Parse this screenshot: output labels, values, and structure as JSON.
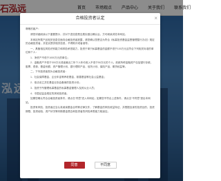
{
  "site": {
    "logo_text": "石泓远",
    "nav": [
      "首页",
      "市场观点",
      "产品中心",
      "关于我们",
      "联系我们"
    ]
  },
  "hero": {
    "text": "泓远"
  },
  "modal": {
    "title": "合格投资者认定",
    "close": "×",
    "greeting": "尊敬的客户：",
    "paragraphs": [
      "请您详细阅读以下重要提示，并对下述信息是否属实做出确认后，方可继续浏览本网站。",
      "本网站所载产品相关信息仅面向合格投资者披露，请您确认您是否为符合《私募投资基金监督管理暂行办法》规定的合格投资者，并如实提供相关信息，不得欺诈或者误导。",
      "一、具备相应风险识别能力和风险承担能力，投资于单只私募基金的金额不低于100万元且符合下列相关标准的单位和个人：",
      "1．净资产不低于1000万元的单位；",
      "2．金融资产不低于300万元或者最近三年个人年均收入不低于50万元的个人。前款所称金融资产包括银行存款、股票、债券、基金份额、资产管理计划、银行理财产品、信托计划、保险产品、期货权益等。",
      "二、下列投资者视为合格投资者：",
      "1．社会保障基金、企业年金等养老基金，慈善基金等社会公益基金；",
      "2．依法设立并在基金业协会备案的投资计划；",
      "3．投资于所管理私募基金的私募基金管理人及其从业人员；",
      "4．中国证监会规定的其他投资者。",
      "如果您确认符合合格投资者条件，请点击“同意”进入本网站；如果您不符合上述条件，请点击“不同意”退出本网站。",
      "投资有风险，投资者应当认真阅读基金合同等法律文件，了解基金的风险收益特征，并根据自身的投资目的、投资期限、投资经验、资产状况等判断基金是否和投资者的风险承受能力相适应。"
    ],
    "agree_label": "同意",
    "disagree_label": "不同意"
  },
  "colors": {
    "brand": "#b2262b"
  }
}
